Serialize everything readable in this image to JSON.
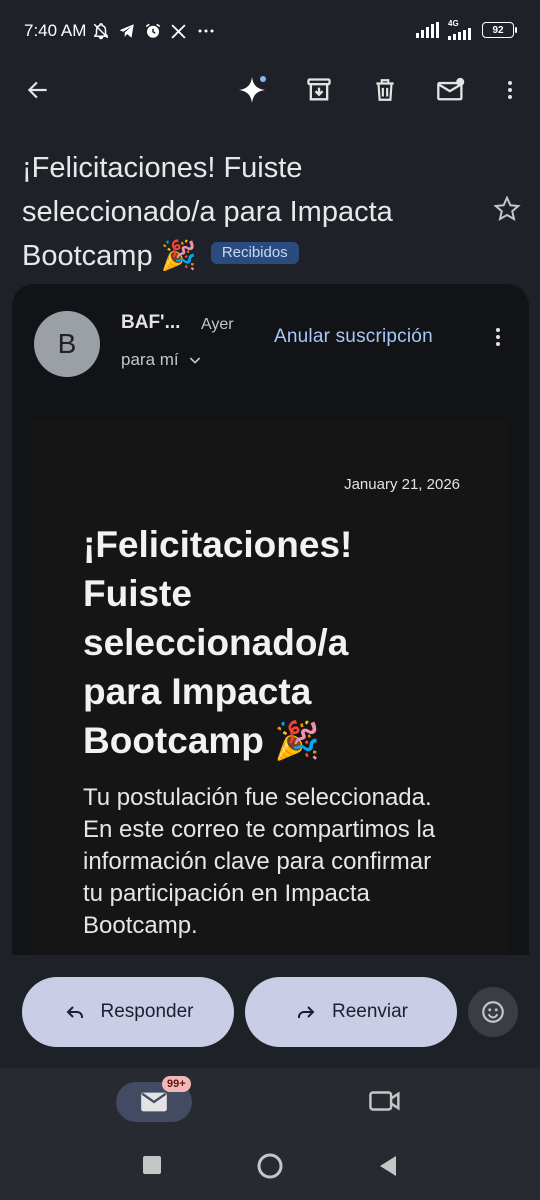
{
  "status_bar": {
    "time": "7:40 AM",
    "network": "4G",
    "battery": "92"
  },
  "app_bar": {
    "icons": [
      "back-arrow-icon",
      "sparkle-icon",
      "archive-icon",
      "delete-icon",
      "mark-unread-icon",
      "more-vert-icon"
    ]
  },
  "email": {
    "subject": "¡Felicitaciones! Fuiste seleccionado/a para Impacta Bootcamp 🎉",
    "label_chip": "Recibidos",
    "sender_initial": "B",
    "sender": "BAF'...",
    "time": "Ayer",
    "recipient": "para mí",
    "unsubscribe": "Anular suscripción",
    "body": {
      "date": "January 21, 2026",
      "heading": "¡Felicitaciones! Fuiste seleccionado/a para Impacta Bootcamp 🎉",
      "paragraph": "Tu postulación fue seleccionada. En este correo te compartimos la información clave para confirmar tu participación en Impacta Bootcamp."
    }
  },
  "actions": {
    "reply": "Responder",
    "forward": "Reenviar"
  },
  "bottom_nav": {
    "mail_badge": "99+"
  },
  "colors": {
    "background": "#1e2127",
    "card": "#111317",
    "accent_link": "#a8c7fa",
    "pill": "#c9cde6",
    "chip": "#2b4a7e"
  }
}
